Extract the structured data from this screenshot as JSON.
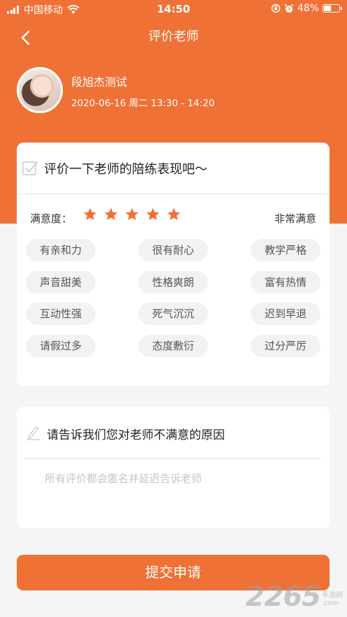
{
  "status_bar": {
    "carrier": "中国移动",
    "time": "14:50",
    "battery_percent": "48%",
    "battery_level": 0.48,
    "icons": [
      "signal-icon",
      "wifi-icon",
      "rotation-lock-icon",
      "alarm-icon",
      "battery-icon"
    ]
  },
  "nav": {
    "title": "评价老师",
    "back_icon": "chevron-left-icon"
  },
  "teacher": {
    "name": "段旭杰测试",
    "session_time": "2020-06-16 周二 13:30 - 14:20"
  },
  "rating": {
    "title": "评价一下老师的陪练表现吧～",
    "satisfaction_label": "满意度：",
    "stars": 5,
    "max_stars": 5,
    "satisfaction_value": "非常满意",
    "tags": [
      "有亲和力",
      "很有耐心",
      "教学严格",
      "声音甜美",
      "性格爽朗",
      "富有热情",
      "互动性强",
      "死气沉沉",
      "迟到早退",
      "请假过多",
      "态度敷衍",
      "过分严厉"
    ]
  },
  "reason": {
    "title": "请告诉我们您对老师不满意的原因",
    "placeholder": "所有评价都会匿名并延迟告诉老师",
    "value": ""
  },
  "submit_label": "提交申请",
  "watermark": {
    "number": "2265",
    "line1": "手游网",
    "line2": ".com"
  },
  "colors": {
    "brand": "#ef7135",
    "background": "#f5f5f5",
    "tag_bg": "#f2f2f2"
  }
}
